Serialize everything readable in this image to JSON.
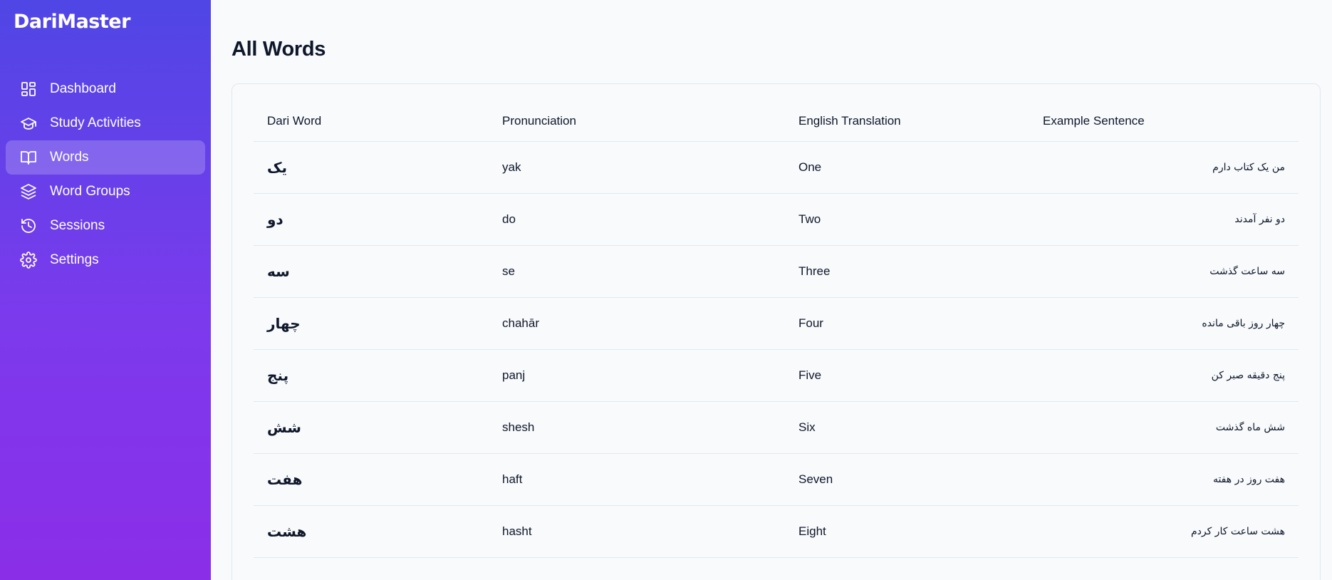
{
  "app": {
    "brand": "DariMaster"
  },
  "sidebar": {
    "items": [
      {
        "label": "Dashboard",
        "icon": "dashboard-icon",
        "active": false
      },
      {
        "label": "Study Activities",
        "icon": "graduation-cap-icon",
        "active": false
      },
      {
        "label": "Words",
        "icon": "book-open-icon",
        "active": true
      },
      {
        "label": "Word Groups",
        "icon": "layers-icon",
        "active": false
      },
      {
        "label": "Sessions",
        "icon": "history-icon",
        "active": false
      },
      {
        "label": "Settings",
        "icon": "gear-icon",
        "active": false
      }
    ]
  },
  "main": {
    "title": "All Words",
    "table": {
      "headers": [
        "Dari Word",
        "Pronunciation",
        "English Translation",
        "Example Sentence"
      ],
      "rows": [
        {
          "dari": "یک",
          "pronunciation": "yak",
          "english": "One",
          "example": "من یک کتاب دارم"
        },
        {
          "dari": "دو",
          "pronunciation": "do",
          "english": "Two",
          "example": "دو نفر آمدند"
        },
        {
          "dari": "سه",
          "pronunciation": "se",
          "english": "Three",
          "example": "سه ساعت گذشت"
        },
        {
          "dari": "چهار",
          "pronunciation": "chahār",
          "english": "Four",
          "example": "چهار روز باقی مانده"
        },
        {
          "dari": "پنج",
          "pronunciation": "panj",
          "english": "Five",
          "example": "پنج دقیقه صبر کن"
        },
        {
          "dari": "شش",
          "pronunciation": "shesh",
          "english": "Six",
          "example": "شش ماه گذشت"
        },
        {
          "dari": "هفت",
          "pronunciation": "haft",
          "english": "Seven",
          "example": "هفت روز در هفته"
        },
        {
          "dari": "هشت",
          "pronunciation": "hasht",
          "english": "Eight",
          "example": "هشت ساعت کار کردم"
        }
      ]
    }
  },
  "colors": {
    "sidebar_gradient_top": "#4f46e5",
    "sidebar_gradient_bottom": "#8b2ee8",
    "background": "#f8fafc",
    "border": "#e2e8f0"
  }
}
